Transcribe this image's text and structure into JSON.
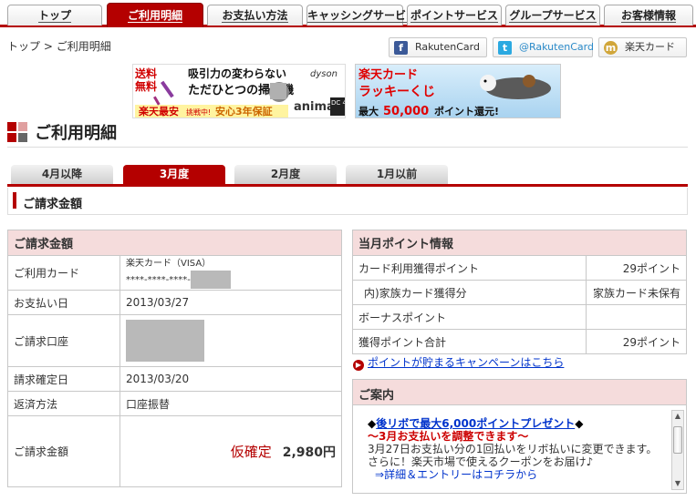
{
  "nav": {
    "tabs": [
      "トップ",
      "ご利用明細",
      "お支払い方法",
      "キャッシングサービス",
      "ポイントサービス",
      "グループサービス",
      "お客様情報"
    ]
  },
  "breadcrumb": {
    "home": "トップ",
    "sep": ">",
    "current": "ご利用明細"
  },
  "social": {
    "facebook": "RakutenCard",
    "twitter": "@RakutenCard",
    "mixi": "楽天カード"
  },
  "banners": {
    "dyson": {
      "line1a": "送料",
      "line1b": "無料",
      "line2": "吸引力の変わらない",
      "brand": "dyson",
      "line3": "ただひとつの掃除機",
      "line4a": "楽天最安",
      "line4b": "挑戦中!",
      "line4c": "安心3年保証",
      "model": "animal",
      "model2": "DC 44"
    },
    "lucky": {
      "title": "楽天カード",
      "line2": "ラッキーくじ",
      "line3a": "最大",
      "line3b": "50,000",
      "line3c": "ポイント還元!"
    }
  },
  "page_title": "ご利用明細",
  "month_tabs": [
    "4月以降",
    "3月度",
    "2月度",
    "1月以前"
  ],
  "section_title": "ご請求金額",
  "billing": {
    "caption": "ご請求金額",
    "card_label": "ご利用カード",
    "card_name": "楽天カード（VISA）",
    "card_number": "****-****-****-",
    "pay_date_label": "お支払い日",
    "pay_date": "2013/03/27",
    "account_label": "ご請求口座",
    "confirm_label": "請求確定日",
    "confirm_date": "2013/03/20",
    "method_label": "返済方法",
    "method": "口座振替",
    "amount_label": "ご請求金額",
    "amount_status": "仮確定",
    "amount": "2,980円"
  },
  "points": {
    "caption": "当月ポイント情報",
    "rows": [
      {
        "label": "カード利用獲得ポイント",
        "value": "29ポイント"
      },
      {
        "label": "内)家族カード獲得分",
        "value": "家族カード未保有"
      },
      {
        "label": "ボーナスポイント",
        "value": ""
      },
      {
        "label": "獲得ポイント合計",
        "value": "29ポイント"
      }
    ],
    "campaign_link": "ポイントが貯まるキャンペーンはこちら"
  },
  "guide": {
    "caption": "ご案内",
    "l1_pre": "◆",
    "l1_link": "後リボで最大6,000ポイントプレゼント",
    "l1_post": "◆",
    "l2": "～3月お支払いを調整できます～",
    "l3": "3月27日お支払い分の1回払いをリボ払いに変更できます。",
    "l4": "さらに！楽天市場で使えるクーポンをお届け♪",
    "l5_arrow": "⇒",
    "l5_link": "詳細＆エントリーはコチラから"
  },
  "colors": {
    "brand_red": "#b40000",
    "header_pink": "#f5dcdc",
    "link_blue": "#0033cc"
  }
}
